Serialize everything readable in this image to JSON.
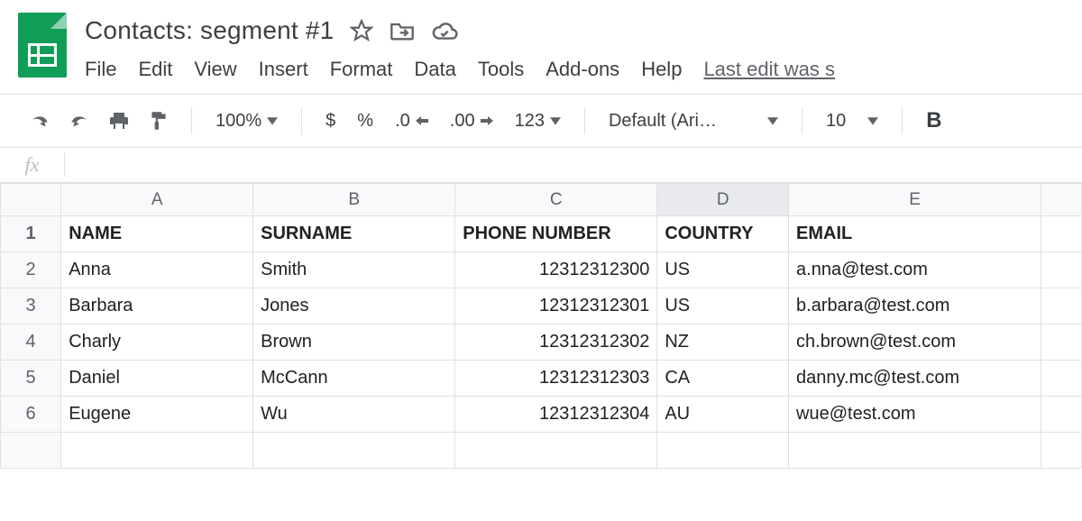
{
  "doc": {
    "title": "Contacts: segment #1"
  },
  "title_icons": {
    "star": "star-outline",
    "move": "move-to-folder",
    "cloud": "cloud-saved"
  },
  "menubar": {
    "items": [
      "File",
      "Edit",
      "View",
      "Insert",
      "Format",
      "Data",
      "Tools",
      "Add-ons",
      "Help"
    ],
    "last_edit": "Last edit was s"
  },
  "toolbar": {
    "zoom": "100%",
    "currency": "$",
    "percent": "%",
    "dec_less": ".0",
    "dec_more": ".00",
    "more_formats": "123",
    "font": "Default (Ari…",
    "font_size": "10",
    "bold": "B"
  },
  "formula_bar": {
    "fx": "fx",
    "value": ""
  },
  "columns": [
    "A",
    "B",
    "C",
    "D",
    "E"
  ],
  "selected_column": "D",
  "row_numbers": [
    1,
    2,
    3,
    4,
    5,
    6
  ],
  "table": {
    "headers": [
      "NAME",
      "SURNAME",
      "PHONE NUMBER",
      "COUNTRY",
      "EMAIL"
    ],
    "rows": [
      {
        "name": "Anna",
        "surname": "Smith",
        "phone": "12312312300",
        "country": "US",
        "email": "a.nna@test.com"
      },
      {
        "name": "Barbara",
        "surname": "Jones",
        "phone": "12312312301",
        "country": "US",
        "email": "b.arbara@test.com"
      },
      {
        "name": "Charly",
        "surname": "Brown",
        "phone": "12312312302",
        "country": "NZ",
        "email": "ch.brown@test.com"
      },
      {
        "name": "Daniel",
        "surname": "McCann",
        "phone": "12312312303",
        "country": "CA",
        "email": "danny.mc@test.com"
      },
      {
        "name": "Eugene",
        "surname": "Wu",
        "phone": "12312312304",
        "country": "AU",
        "email": "wue@test.com"
      }
    ]
  }
}
